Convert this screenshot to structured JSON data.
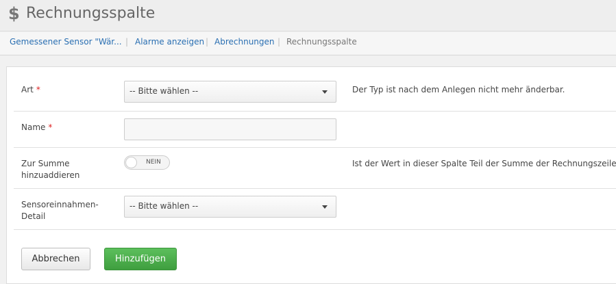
{
  "header": {
    "icon": "dollar-icon",
    "icon_glyph": "$",
    "title": "Rechnungsspalte"
  },
  "breadcrumb": {
    "items": [
      {
        "label": "Gemessener Sensor \"Wär..."
      },
      {
        "label": "Alarme anzeigen"
      },
      {
        "label": "Abrechnungen"
      },
      {
        "label": "Rechnungsspalte"
      }
    ],
    "separator": "|"
  },
  "form": {
    "art": {
      "label": "Art",
      "required_mark": "*",
      "selected": "-- Bitte wählen --",
      "help": "Der Typ ist nach dem Anlegen nicht mehr änderbar."
    },
    "name": {
      "label": "Name",
      "required_mark": "*",
      "value": ""
    },
    "sum": {
      "label_line1": "Zur Summe",
      "label_line2": "hinzuaddieren",
      "toggle_text": "NEIN",
      "help": "Ist der Wert in dieser Spalte Teil der Summe der Rechnungszeile?"
    },
    "detail": {
      "label_line1": "Sensoreinnahmen-",
      "label_line2": "Detail",
      "selected": "-- Bitte wählen --"
    }
  },
  "buttons": {
    "cancel": "Abbrechen",
    "add": "Hinzufügen"
  },
  "colors": {
    "link": "#2a6fb2",
    "required": "#dd2222",
    "primary": "#4cae4c"
  }
}
